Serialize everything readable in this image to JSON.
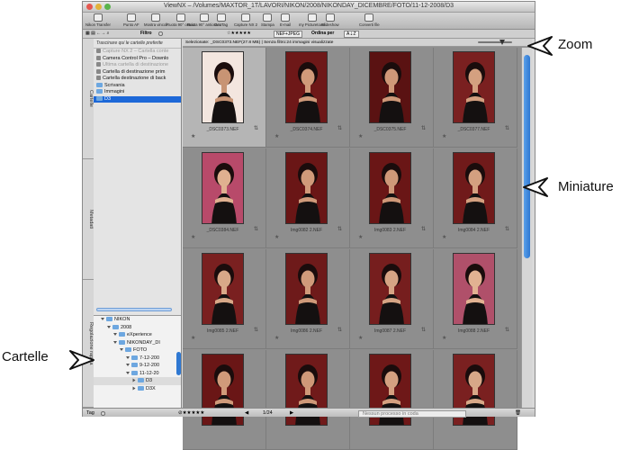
{
  "window": {
    "title": "ViewNX – /Volumes/MAXTOR_1T/LAVORI/NIKON/2008/NIKONDAY_DICEMBRE/FOTO/11-12-2008/D3"
  },
  "toolbar": {
    "buttons": [
      {
        "label": "Nikon Transfer",
        "icon": "transfer-icon"
      },
      {
        "label": "Punto AF",
        "icon": "focus-point-icon"
      },
      {
        "label": "Mostra vincoli",
        "icon": "constraints-icon"
      },
      {
        "label": "Ruota 90° orario",
        "icon": "rotate-cw-icon"
      },
      {
        "label": "Ruota 90° antiorario",
        "icon": "rotate-ccw-icon"
      },
      {
        "label": "GeoTag",
        "icon": "geotag-icon"
      },
      {
        "label": "Capture NX 2",
        "icon": "capture-nx-icon"
      },
      {
        "label": "Stampa",
        "icon": "print-icon"
      },
      {
        "label": "E-mail",
        "icon": "email-icon"
      },
      {
        "label": "my Picturetown",
        "icon": "picturetown-icon"
      },
      {
        "label": "Slideshow",
        "icon": "slideshow-icon"
      },
      {
        "label": "Converti file",
        "icon": "convert-icon"
      }
    ]
  },
  "filterbar": {
    "filter_label": "Filtro",
    "rating_value": "NEF+JPEG",
    "sort_label": "Ordina per"
  },
  "sidebar": {
    "tabs": [
      "Cartelle",
      "Metadati",
      "Regolazione rapida"
    ],
    "favorites_header": "Trascinare qui le cartelle preferite",
    "favorites": [
      {
        "label": "Capture NX 2 – Cartella conte",
        "dim": true
      },
      {
        "label": "Camera Control Pro – Downlo",
        "dim": false
      },
      {
        "label": "Ultima cartella di destinazione",
        "dim": true
      },
      {
        "label": "Cartella di destinazione prim",
        "dim": false
      },
      {
        "label": "Cartella destinazione di back",
        "dim": false
      },
      {
        "label": "Scrivania",
        "dim": false
      },
      {
        "label": "Immagini",
        "dim": false
      },
      {
        "label": "D3",
        "dim": false,
        "selected": true
      }
    ],
    "tree": [
      {
        "label": "NIKON",
        "level": 0
      },
      {
        "label": "2008",
        "level": 1
      },
      {
        "label": "eXperience",
        "level": 2
      },
      {
        "label": "NIKONDAY_DI",
        "level": 2
      },
      {
        "label": "FOTO",
        "level": 3
      },
      {
        "label": "7-12-200",
        "level": 4
      },
      {
        "label": "9-12-200",
        "level": 4
      },
      {
        "label": "11-12-20",
        "level": 4
      },
      {
        "label": "D3",
        "level": 5
      },
      {
        "label": "D3X",
        "level": 5
      }
    ]
  },
  "main": {
    "infobar": "Selezionate: _DSC0373.NEF(27.8 MB) | Senza filtro:24 immagini visualizzate",
    "zoom_level": 0.72,
    "thumbnails": [
      {
        "name": "_DSC0373.NEF",
        "selected": true,
        "bg": "#f3e6df",
        "skin": "#c89474"
      },
      {
        "name": "_DSC0374.NEF",
        "selected": false,
        "bg": "#6e1818",
        "skin": "#d09a7a"
      },
      {
        "name": "_DSC0375.NEF",
        "selected": false,
        "bg": "#5a1212",
        "skin": "#cf9878"
      },
      {
        "name": "_DSC0377.NEF",
        "selected": false,
        "bg": "#7a2020",
        "skin": "#d4a080"
      },
      {
        "name": "_DSC0384.NEF",
        "selected": false,
        "bg": "#b84a6a",
        "skin": "#e0b090"
      },
      {
        "name": "Img0082 2.NEF",
        "selected": false,
        "bg": "#6a1616",
        "skin": "#d09a7a"
      },
      {
        "name": "Img0083 2.NEF",
        "selected": false,
        "bg": "#6a1616",
        "skin": "#cf9878"
      },
      {
        "name": "Img0084 2.NEF",
        "selected": false,
        "bg": "#701a1a",
        "skin": "#d4a080"
      },
      {
        "name": "Img0085 2.NEF",
        "selected": false,
        "bg": "#7a2020",
        "skin": "#d8a888"
      },
      {
        "name": "Img0086 2.NEF",
        "selected": false,
        "bg": "#6e1a1a",
        "skin": "#d09a7a"
      },
      {
        "name": "Img0087 2.NEF",
        "selected": false,
        "bg": "#761e1e",
        "skin": "#d6a484"
      },
      {
        "name": "Img0088 2.NEF",
        "selected": false,
        "bg": "#b0506a",
        "skin": "#e2b292"
      },
      {
        "name": "",
        "selected": false,
        "bg": "#6a1616",
        "skin": "#d09a7a"
      },
      {
        "name": "",
        "selected": false,
        "bg": "#701a1a",
        "skin": "#cf9878"
      },
      {
        "name": "",
        "selected": false,
        "bg": "#6e1818",
        "skin": "#d4a080"
      },
      {
        "name": "",
        "selected": false,
        "bg": "#7a2020",
        "skin": "#d8a888"
      }
    ]
  },
  "statusbar": {
    "tag_label": "Tag",
    "page": "1/24",
    "process_label": "Nessun processo in coda"
  },
  "callouts": {
    "zoom": "Zoom",
    "thumbnails": "Miniature",
    "folders": "Cartelle"
  },
  "colors": {
    "selection_blue": "#1d68d8",
    "scroll_blue": "#2f78d2",
    "label_dots": [
      "#ff6a6a",
      "#f2a33a",
      "#e6d43a",
      "#6ac36a",
      "#5aa0ea",
      "#a46ad6",
      "#e87ab0",
      "#b0b0b0",
      "#8a8a8a",
      "#d8d8d8"
    ]
  }
}
